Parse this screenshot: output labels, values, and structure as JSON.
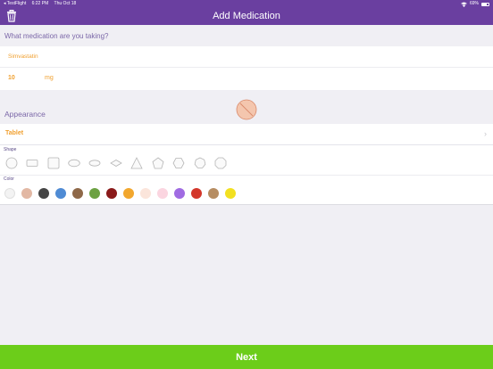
{
  "status_bar": {
    "back_app": "◂ TestFlight",
    "time": "6:22 PM",
    "date": "Thu Oct 18",
    "battery": "69%"
  },
  "header": {
    "title": "Add Medication",
    "delete_icon": "trash-icon"
  },
  "medication": {
    "question": "What medication are you taking?",
    "name_value": "Simvastatin",
    "dose_value": "10",
    "dose_unit": "mg"
  },
  "appearance": {
    "label": "Appearance",
    "preview_icon": "pill-preview-icon",
    "form_value": "Tablet",
    "shape_label": "Shape",
    "shapes": [
      "round",
      "rectangle",
      "square",
      "oval",
      "capsule-oval",
      "diamond",
      "triangle",
      "pentagon",
      "hexagon",
      "heptagon",
      "octagon"
    ],
    "color_label": "Color",
    "colors": [
      "#f3f3f3",
      "#e2b8a4",
      "#454545",
      "#4f8bd4",
      "#8e6848",
      "#6ca142",
      "#8a1a1a",
      "#f2a72e",
      "#fbe5db",
      "#fbd5e0",
      "#a06be2",
      "#d3372b",
      "#b68d62",
      "#f2e020"
    ]
  },
  "footer": {
    "next_label": "Next"
  }
}
